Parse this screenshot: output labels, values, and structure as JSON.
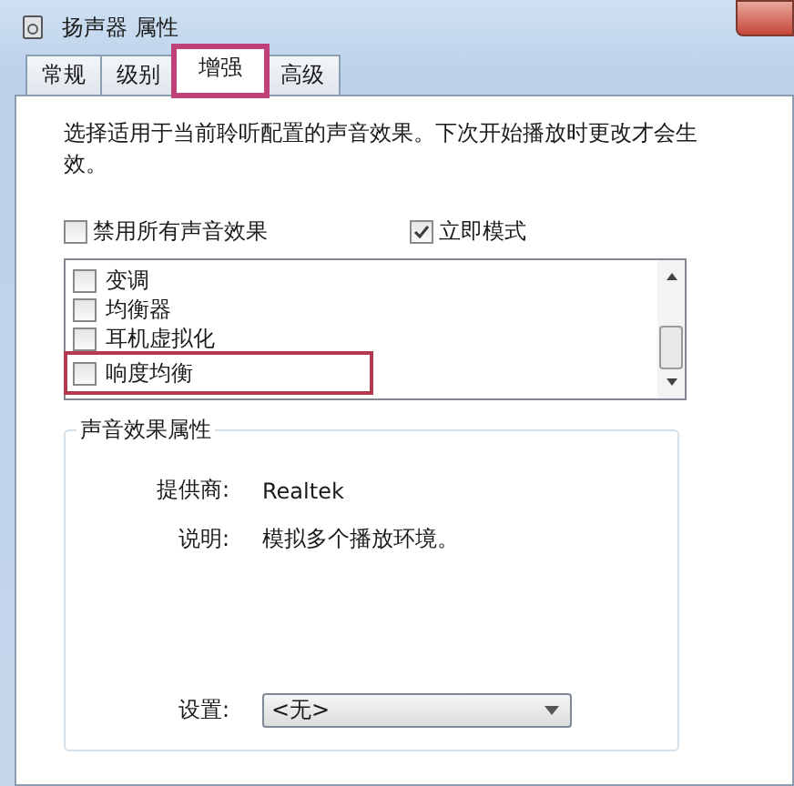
{
  "window": {
    "title": "扬声器 属性"
  },
  "tabs": [
    {
      "label": "常规",
      "selected": false,
      "highlighted": false
    },
    {
      "label": "级别",
      "selected": false,
      "highlighted": false
    },
    {
      "label": "增强",
      "selected": true,
      "highlighted": true
    },
    {
      "label": "高级",
      "selected": false,
      "highlighted": false
    }
  ],
  "intro": "选择适用于当前聆听配置的声音效果。下次开始播放时更改才会生效。",
  "options": [
    {
      "label": "禁用所有声音效果",
      "checked": false
    },
    {
      "label": "立即模式",
      "checked": true
    }
  ],
  "effects": [
    {
      "label": "变调",
      "checked": false,
      "highlighted": false
    },
    {
      "label": "均衡器",
      "checked": false,
      "highlighted": false
    },
    {
      "label": "耳机虚拟化",
      "checked": false,
      "highlighted": false
    },
    {
      "label": "响度均衡",
      "checked": false,
      "highlighted": true
    }
  ],
  "properties": {
    "title": "声音效果属性",
    "rows": [
      {
        "label": "提供商:",
        "value": "Realtek"
      },
      {
        "label": "说明:",
        "value": "模拟多个播放环境。"
      }
    ],
    "setting": {
      "label": "设置:",
      "value": "<无>"
    }
  }
}
